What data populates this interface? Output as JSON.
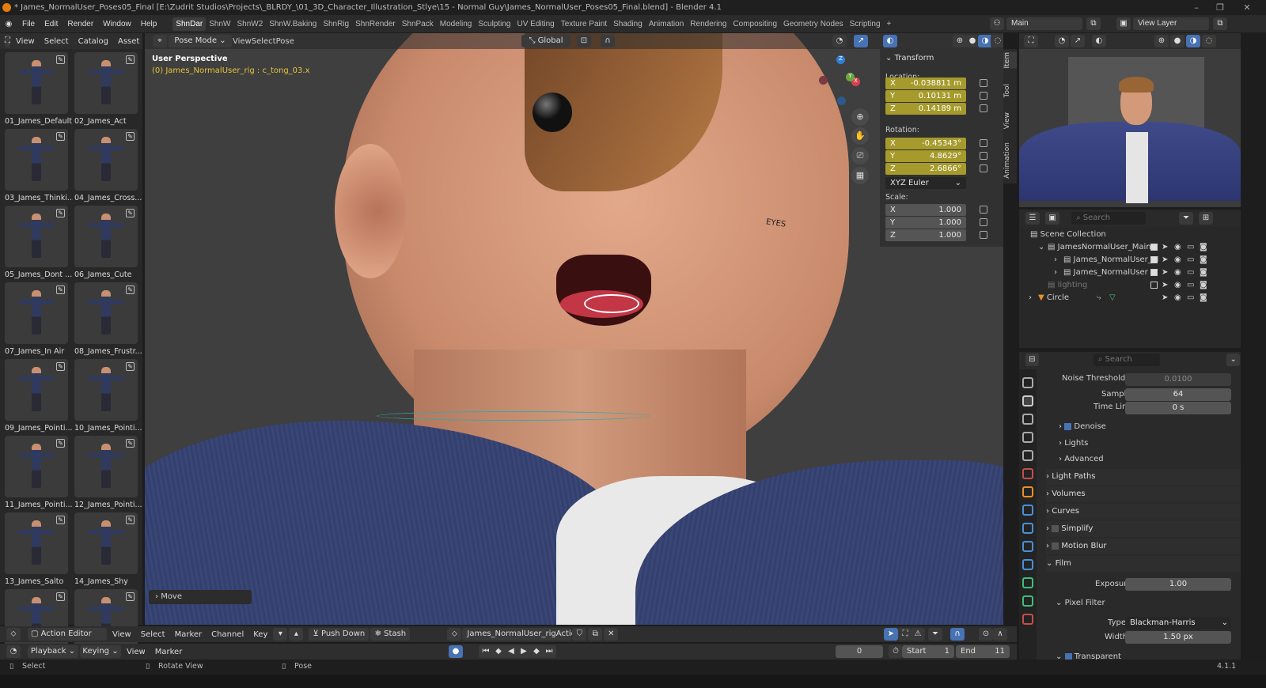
{
  "window": {
    "title": "* James_NormalUser_Poses05_Final [E:\\Zudrit Studios\\Projects\\_BLRDY_\\01_3D_Character_Illustration_Stlye\\15 - Normal Guy\\James_NormalUser_Poses05_Final.blend] - Blender 4.1",
    "minimize": "–",
    "maximize": "❐",
    "close": "✕"
  },
  "menu": [
    "File",
    "Edit",
    "Render",
    "Window",
    "Help"
  ],
  "workspaces": [
    "ShnDar",
    "ShnW",
    "ShnW2",
    "ShnW.Baking",
    "ShnRig",
    "ShnRender",
    "ShnPack",
    "Modeling",
    "Sculpting",
    "UV Editing",
    "Texture Paint",
    "Shading",
    "Animation",
    "Rendering",
    "Compositing",
    "Geometry Nodes",
    "Scripting",
    "+"
  ],
  "scene": {
    "name": "Main",
    "view_layer": "View Layer"
  },
  "asset_header": [
    "View",
    "Select",
    "Catalog",
    "Asset"
  ],
  "assets": [
    "01_James_Default",
    "02_James_Act",
    "03_James_Thinki...",
    "04_James_Cross...",
    "05_James_Dont ...",
    "06_James_Cute",
    "07_James_In Air",
    "08_James_Frustr...",
    "09_James_Pointi...",
    "10_James_Pointi...",
    "11_James_Pointi...",
    "12_James_Pointi...",
    "13_James_Salto",
    "14_James_Shy",
    "",
    ""
  ],
  "viewport": {
    "mode": "Pose Mode",
    "menus": [
      "View",
      "Select",
      "Pose"
    ],
    "orientation": "Global",
    "perspective": "User Perspective",
    "active": "(0) James_NormalUser_rig : c_tong_03.x",
    "operator": "Move",
    "annotation": "EYES"
  },
  "transform": {
    "title": "Transform",
    "location_label": "Location:",
    "location": [
      [
        "X",
        "-0.038811 m"
      ],
      [
        "Y",
        "0.10131 m"
      ],
      [
        "Z",
        "0.14189 m"
      ]
    ],
    "rotation_label": "Rotation:",
    "rotation": [
      [
        "X",
        "-0.45343°"
      ],
      [
        "Y",
        "4.8629°"
      ],
      [
        "Z",
        "2.6866°"
      ]
    ],
    "rotation_mode": "XYZ Euler",
    "scale_label": "Scale:",
    "scale": [
      [
        "X",
        "1.000"
      ],
      [
        "Y",
        "1.000"
      ],
      [
        "Z",
        "1.000"
      ]
    ]
  },
  "ntabs": [
    "Item",
    "Tool",
    "View",
    "Animation"
  ],
  "gizmo": {
    "x": "X",
    "y": "Y",
    "z": "Z"
  },
  "outliner": {
    "search": "Search",
    "rows": [
      {
        "name": "Scene Collection"
      },
      {
        "name": "JamesNormalUser_Main"
      },
      {
        "name": "James_NormalUser_M"
      },
      {
        "name": "James_NormalUser"
      },
      {
        "name": "lighting"
      },
      {
        "name": "Circle"
      }
    ]
  },
  "properties": {
    "search": "Search",
    "noise_threshold_label": "Noise Threshold",
    "noise_threshold": "0.0100",
    "samples_label": "Samples",
    "samples": "64",
    "time_limit_label": "Time Limit",
    "time_limit": "0 s",
    "denoise": "Denoise",
    "lights": "Lights",
    "advanced": "Advanced",
    "light_paths": "Light Paths",
    "volumes": "Volumes",
    "curves": "Curves",
    "simplify": "Simplify",
    "motion_blur": "Motion Blur",
    "film": "Film",
    "exposure_label": "Exposure",
    "exposure": "1.00",
    "pixel_filter": "Pixel Filter",
    "type_label": "Type",
    "type": "Blackman-Harris",
    "width_label": "Width",
    "width": "1.50 px",
    "transparent": "Transparent"
  },
  "action_editor": {
    "mode": "Action Editor",
    "menus": [
      "View",
      "Select",
      "Marker",
      "Channel",
      "Key"
    ],
    "push_down": "Push Down",
    "stash": "Stash",
    "action": "James_NormalUser_rigAction"
  },
  "timeline": {
    "menus": [
      "Playback",
      "Keying",
      "View",
      "Marker"
    ],
    "frame": "0",
    "start_label": "Start",
    "start": "1",
    "end_label": "End",
    "end": "11"
  },
  "status": {
    "select": "Select",
    "rotate": "Rotate View",
    "pose": "Pose",
    "version": "4.1.1"
  }
}
